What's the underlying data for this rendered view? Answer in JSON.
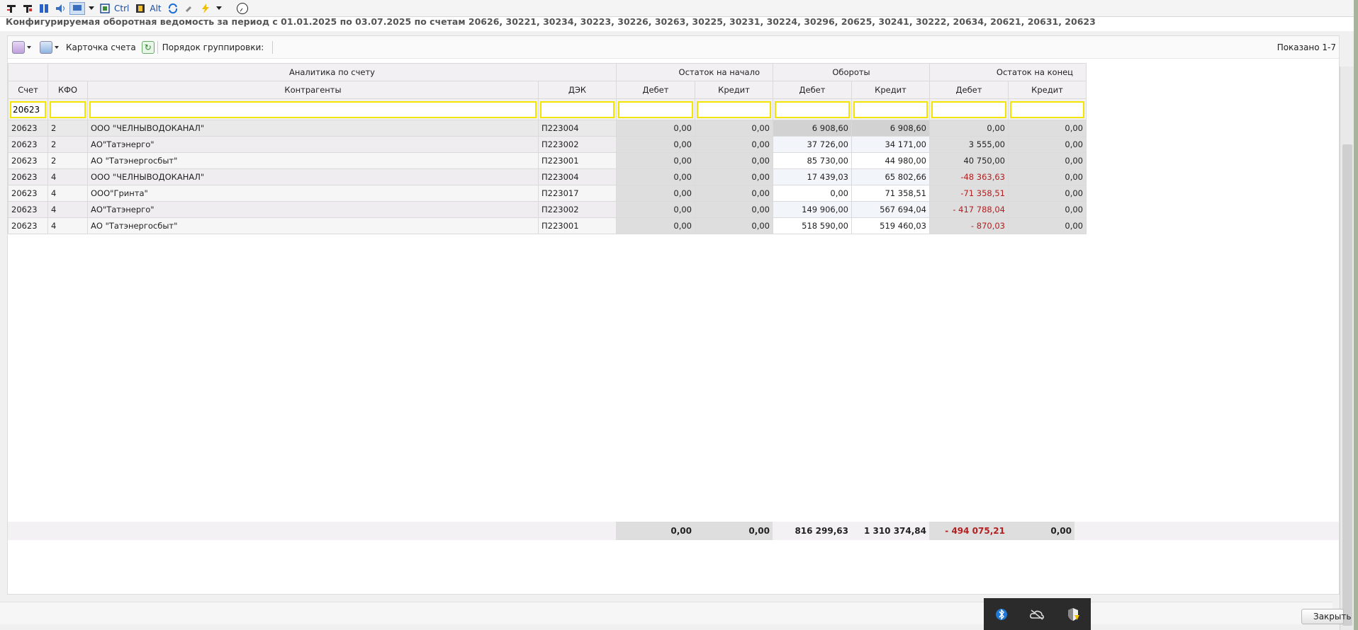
{
  "toolbar": {
    "ctrl_label": "Ctrl",
    "alt_label": "Alt"
  },
  "report_title": "Конфигурируемая оборотная ведомость за период с 01.01.2025 по 03.07.2025 по счетам 20626, 30221, 30234, 30223, 30226, 30263, 30225, 30231, 30224, 30296, 20625, 30241, 30222, 20634, 20621, 20631, 20623",
  "panel_toolbar": {
    "account_card_label": "Карточка счета",
    "grouping_order_label": "Порядок группировки:",
    "shown_label": "Показано 1-7"
  },
  "table": {
    "group_headers": [
      "Аналитика по счету",
      "Остаток на начало",
      "Обороты",
      "Остаток на конец"
    ],
    "columns": [
      "Счет",
      "КФО",
      "Контрагенты",
      "ДЭК",
      "Дебет",
      "Кредит",
      "Дебет",
      "Кредит",
      "Дебет",
      "Кредит"
    ],
    "filters": {
      "account": "20623"
    },
    "rows": [
      {
        "account": "20623",
        "kfo": "2",
        "counterparty": "ООО \"ЧЕЛНЫВОДОКАНАЛ\"",
        "dek": "П223004",
        "start_debit": "0,00",
        "start_credit": "0,00",
        "turn_debit": "6 908,60",
        "turn_credit": "6 908,60",
        "end_debit": "0,00",
        "end_credit": "0,00"
      },
      {
        "account": "20623",
        "kfo": "2",
        "counterparty": "АО\"Татэнерго\"",
        "dek": "П223002",
        "start_debit": "0,00",
        "start_credit": "0,00",
        "turn_debit": "37 726,00",
        "turn_credit": "34 171,00",
        "end_debit": "3 555,00",
        "end_credit": "0,00"
      },
      {
        "account": "20623",
        "kfo": "2",
        "counterparty": "АО \"Татэнергосбыт\"",
        "dek": "П223001",
        "start_debit": "0,00",
        "start_credit": "0,00",
        "turn_debit": "85 730,00",
        "turn_credit": "44 980,00",
        "end_debit": "40 750,00",
        "end_credit": "0,00"
      },
      {
        "account": "20623",
        "kfo": "4",
        "counterparty": "ООО \"ЧЕЛНЫВОДОКАНАЛ\"",
        "dek": "П223004",
        "start_debit": "0,00",
        "start_credit": "0,00",
        "turn_debit": "17 439,03",
        "turn_credit": "65 802,66",
        "end_debit": "-48 363,63",
        "end_credit": "0,00"
      },
      {
        "account": "20623",
        "kfo": "4",
        "counterparty": "ООО\"Гринта\"",
        "dek": "П223017",
        "start_debit": "0,00",
        "start_credit": "0,00",
        "turn_debit": "0,00",
        "turn_credit": "71 358,51",
        "end_debit": "-71 358,51",
        "end_credit": "0,00"
      },
      {
        "account": "20623",
        "kfo": "4",
        "counterparty": "АО\"Татэнерго\"",
        "dek": "П223002",
        "start_debit": "0,00",
        "start_credit": "0,00",
        "turn_debit": "149 906,00",
        "turn_credit": "567 694,04",
        "end_debit": "- 417 788,04",
        "end_credit": "0,00"
      },
      {
        "account": "20623",
        "kfo": "4",
        "counterparty": "АО \"Татэнергосбыт\"",
        "dek": "П223001",
        "start_debit": "0,00",
        "start_credit": "0,00",
        "turn_debit": "518 590,00",
        "turn_credit": "519 460,03",
        "end_debit": "- 870,03",
        "end_credit": "0,00"
      }
    ],
    "totals": {
      "start_debit": "0,00",
      "start_credit": "0,00",
      "turn_debit": "816 299,63",
      "turn_credit": "1 310 374,84",
      "end_debit": "- 494 075,21",
      "end_credit": "0,00"
    }
  },
  "close_label": "Закрыть",
  "tray_icons": [
    "bluetooth-icon",
    "cloud-offline-icon",
    "security-warning-icon"
  ]
}
